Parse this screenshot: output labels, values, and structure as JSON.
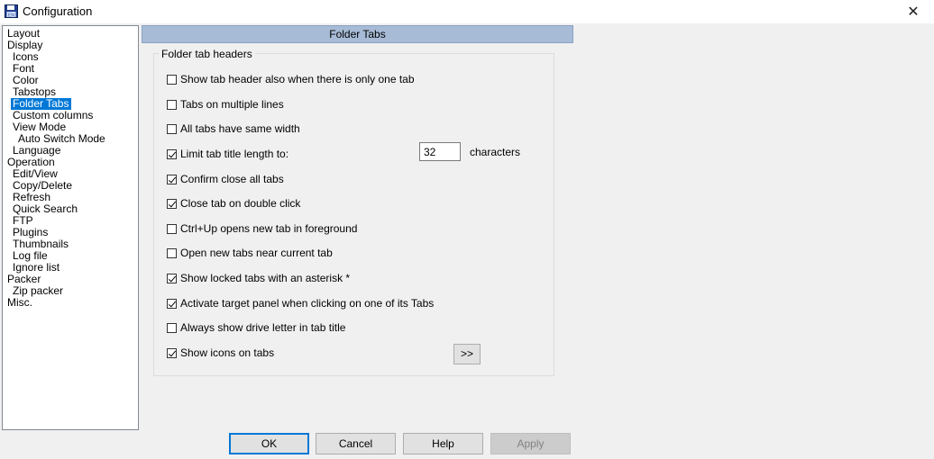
{
  "window": {
    "title": "Configuration",
    "icon": "floppy-disk-icon",
    "close_glyph": "✕"
  },
  "tree": [
    {
      "label": "Layout",
      "level": 0
    },
    {
      "label": "Display",
      "level": 0
    },
    {
      "label": "Icons",
      "level": 1
    },
    {
      "label": "Font",
      "level": 1
    },
    {
      "label": "Color",
      "level": 1
    },
    {
      "label": "Tabstops",
      "level": 1
    },
    {
      "label": "Folder Tabs",
      "level": 1,
      "selected": true
    },
    {
      "label": "Custom columns",
      "level": 1
    },
    {
      "label": "View Mode",
      "level": 1
    },
    {
      "label": "Auto Switch Mode",
      "level": 2
    },
    {
      "label": "Language",
      "level": 1
    },
    {
      "label": "Operation",
      "level": 0
    },
    {
      "label": "Edit/View",
      "level": 1
    },
    {
      "label": "Copy/Delete",
      "level": 1
    },
    {
      "label": "Refresh",
      "level": 1
    },
    {
      "label": "Quick Search",
      "level": 1
    },
    {
      "label": "FTP",
      "level": 1
    },
    {
      "label": "Plugins",
      "level": 1
    },
    {
      "label": "Thumbnails",
      "level": 1
    },
    {
      "label": "Log file",
      "level": 1
    },
    {
      "label": "Ignore list",
      "level": 1
    },
    {
      "label": "Packer",
      "level": 0
    },
    {
      "label": "Zip packer",
      "level": 1
    },
    {
      "label": "Misc.",
      "level": 0
    }
  ],
  "panel": {
    "header": "Folder Tabs",
    "group_label": "Folder tab headers",
    "options": [
      {
        "label": "Show tab header also when there is only one tab",
        "checked": false
      },
      {
        "label": "Tabs on multiple lines",
        "checked": false
      },
      {
        "label": "All tabs have same width",
        "checked": false
      },
      {
        "label": "Limit tab title length to:",
        "checked": true
      },
      {
        "label": "Confirm close all tabs",
        "checked": true
      },
      {
        "label": "Close tab on double click",
        "checked": true
      },
      {
        "label": "Ctrl+Up opens new tab in foreground",
        "checked": false
      },
      {
        "label": "Open new tabs near current tab",
        "checked": false
      },
      {
        "label": "Show locked tabs with an asterisk *",
        "checked": true
      },
      {
        "label": "Activate target panel when clicking on one of its Tabs",
        "checked": true
      },
      {
        "label": "Always show drive letter in tab title",
        "checked": false
      },
      {
        "label": "Show icons on tabs",
        "checked": true
      }
    ],
    "limit_value": "32",
    "limit_unit": "characters",
    "more_button": ">>"
  },
  "buttons": {
    "ok": "OK",
    "cancel": "Cancel",
    "help": "Help",
    "apply": "Apply"
  }
}
